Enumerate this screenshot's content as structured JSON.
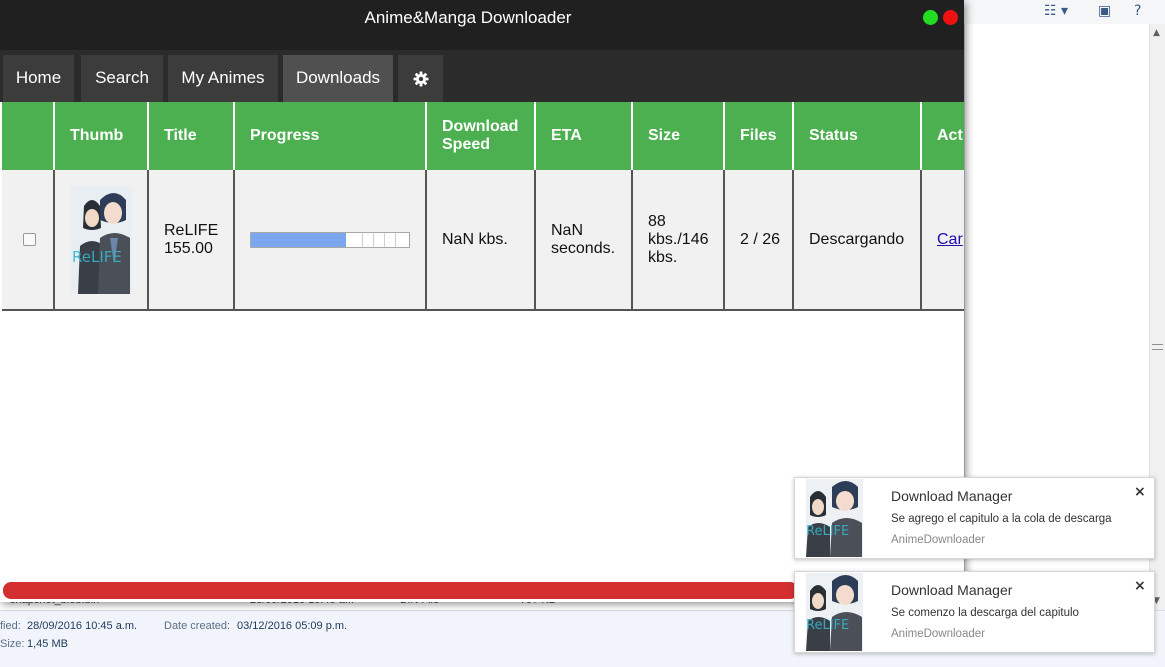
{
  "app": {
    "title": "Anime&Manga Downloader",
    "accent": "#4caf50",
    "titlebar_color": "#202020",
    "close_color": "#ee1111",
    "minimize_color": "#22dd22"
  },
  "nav": {
    "tabs": [
      {
        "label": "Home"
      },
      {
        "label": "Search"
      },
      {
        "label": "My Animes"
      },
      {
        "label": "Downloads",
        "active": true
      },
      {
        "icon": "gear-icon"
      }
    ]
  },
  "table": {
    "columns": [
      "Thumb",
      "Title",
      "Progress",
      "Download Speed",
      "ETA",
      "Size",
      "Files",
      "Status",
      "Act"
    ],
    "rows": [
      {
        "selected": false,
        "thumb_icon": "anime-thumbnail-image",
        "title": "ReLIFE 155.00",
        "progress": 0.6,
        "speed": "NaN kbs.",
        "eta": "NaN seconds.",
        "size": "88 kbs./146 kbs.",
        "files": "2 / 26",
        "status": "Descargando",
        "action": "Car"
      }
    ]
  },
  "notifications": [
    {
      "title": "Download Manager",
      "message": "Se agrego el capitulo a la cola de descarga",
      "source": "AnimeDownloader"
    },
    {
      "title": "Download Manager",
      "message": "Se comenzo la descarga del capitulo",
      "source": "AnimeDownloader"
    }
  ],
  "background": {
    "file_row": {
      "name": "snapshot_blob.bin",
      "date": "28/09/2016 10:45 a...",
      "type": "BIN File",
      "size": "797 KB"
    },
    "details": {
      "modified_label": "fied:",
      "modified_value": "28/09/2016 10:45 a.m.",
      "created_label": "Date created:",
      "created_value": "03/12/2016 05:09 p.m.",
      "size_label": "Size:",
      "size_value": "1,45 MB"
    }
  }
}
